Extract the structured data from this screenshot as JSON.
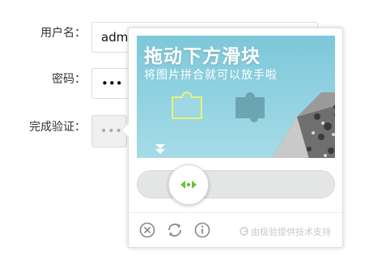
{
  "form": {
    "username_label": "用户名：",
    "username_value": "admin",
    "password_label": "密码：",
    "password_value": "•••",
    "verify_label": "完成验证：",
    "verify_placeholder": "•••"
  },
  "captcha": {
    "title": "拖动下方滑块",
    "subtitle": "将图片拼合就可以放手啦",
    "footer_credit": "由极验提供技术支持",
    "tools": [
      "close-icon",
      "refresh-icon",
      "info-icon"
    ],
    "accent_color": "#67c23a",
    "image_bg_color": "#8ed0e0"
  }
}
